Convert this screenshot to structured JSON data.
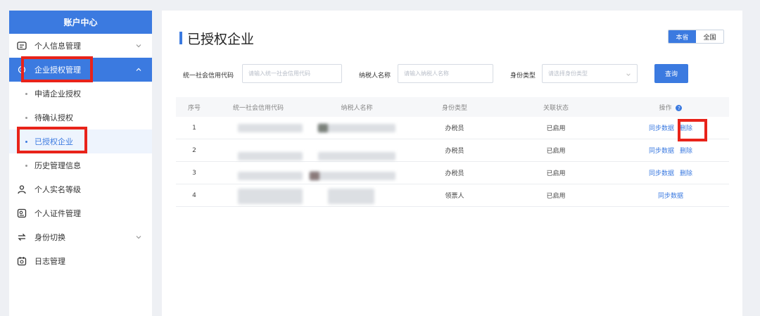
{
  "sidebar": {
    "header": "账户中心",
    "items": [
      {
        "label": "个人信息管理"
      },
      {
        "label": "企业授权管理"
      },
      {
        "label": "个人实名等级"
      },
      {
        "label": "个人证件管理"
      },
      {
        "label": "身份切换"
      },
      {
        "label": "日志管理"
      }
    ],
    "subitems": [
      {
        "label": "申请企业授权"
      },
      {
        "label": "待确认授权"
      },
      {
        "label": "已授权企业"
      },
      {
        "label": "历史管理信息"
      }
    ]
  },
  "main": {
    "title": "已授权企业",
    "seg": {
      "local": "本省",
      "all": "全国"
    },
    "filters": {
      "credit_label": "统一社会信用代码",
      "credit_placeholder": "请输入统一社会信用代码",
      "name_label": "纳税人名称",
      "name_placeholder": "请输入纳税人名称",
      "type_label": "身份类型",
      "type_placeholder": "请选择身份类型",
      "query": "查询"
    },
    "table": {
      "headers": [
        "序号",
        "统一社会信用代码",
        "纳税人名称",
        "身份类型",
        "关联状态",
        "操作"
      ],
      "rows": [
        {
          "no": "1",
          "type": "办税员",
          "status": "已启用",
          "sync": "同步数据",
          "del": "删除"
        },
        {
          "no": "2",
          "type": "办税员",
          "status": "已启用",
          "sync": "同步数据",
          "del": "删除"
        },
        {
          "no": "3",
          "type": "办税员",
          "status": "已启用",
          "sync": "同步数据",
          "del": "删除"
        },
        {
          "no": "4",
          "type": "领票人",
          "status": "已启用",
          "sync": "同步数据"
        }
      ]
    }
  },
  "colors": {
    "accent": "#3b7ae0",
    "highlight": "#e8231a"
  }
}
